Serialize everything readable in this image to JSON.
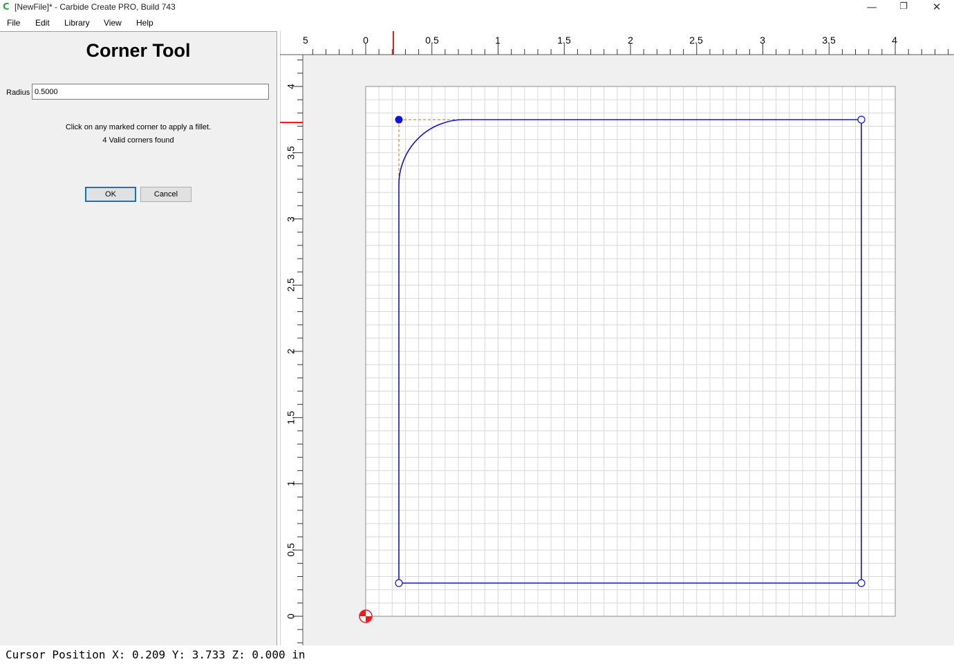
{
  "window": {
    "title": "[NewFile]* - Carbide Create PRO, Build 743",
    "icon": "carbide-c-icon",
    "controls": {
      "minimize": "—",
      "restore": "❐",
      "close": "✕"
    }
  },
  "menu": [
    {
      "label": "File"
    },
    {
      "label": "Edit"
    },
    {
      "label": "Library"
    },
    {
      "label": "View"
    },
    {
      "label": "Help"
    }
  ],
  "panel": {
    "title": "Corner Tool",
    "radius_label": "Radius",
    "radius_value": "0.5000",
    "message_1": "Click on any marked corner to apply a fillet.",
    "message_2": "4 Valid corners found",
    "ok_label": "OK",
    "cancel_label": "Cancel"
  },
  "ruler": {
    "top_labels": [
      "5",
      "0",
      "0.5",
      "1",
      "1.5",
      "2",
      "2.5",
      "3",
      "3.5",
      "4"
    ],
    "left_labels": [
      "4",
      "3.5",
      "3",
      "2.5",
      "2",
      "1.5",
      "1",
      "0.5",
      "0"
    ],
    "cursor_marker_color": "#ee1c1c"
  },
  "design": {
    "shape_color": "#1010e0",
    "guide_color": "#f08020",
    "selected_corner": "top-left",
    "fillet_radius": 0.5
  },
  "status": {
    "text": "Cursor Position X: 0.209 Y: 3.733 Z: 0.000 in"
  }
}
